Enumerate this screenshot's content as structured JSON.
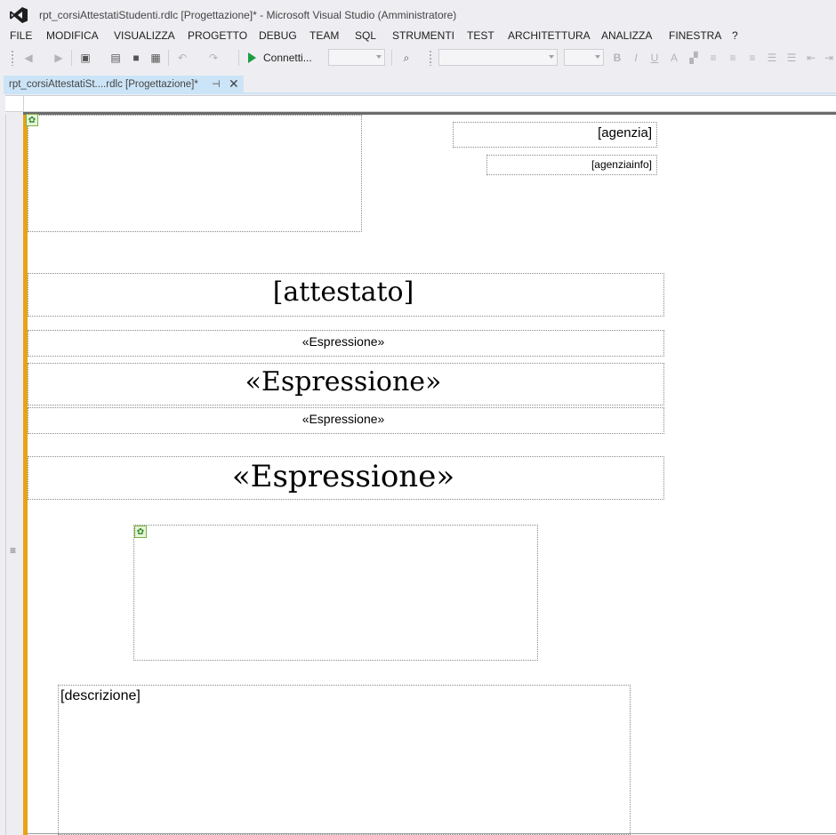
{
  "window": {
    "title": "rpt_corsiAttestatiStudenti.rdlc [Progettazione]* - Microsoft Visual Studio (Amministratore)"
  },
  "menu": [
    "FILE",
    "MODIFICA",
    "VISUALIZZA",
    "PROGETTO",
    "DEBUG",
    "TEAM",
    "SQL",
    "STRUMENTI",
    "TEST",
    "ARCHITETTURA",
    "ANALIZZA",
    "FINESTRA",
    "?"
  ],
  "toolbar": {
    "start_label": "Connetti...",
    "bold_label": "B",
    "italic_label": "I",
    "underline_label": "U"
  },
  "tab": {
    "label": "rpt_corsiAttestatiSt....rdlc [Progettazione]*",
    "pin_glyph": "⊣",
    "close_glyph": "✕"
  },
  "report": {
    "agenzia": "[agenzia]",
    "agenziainfo": "[agenziainfo]",
    "attestato": "[attestato]",
    "expr_small_1": "«Espressione»",
    "expr_large_1": "«Espressione»",
    "expr_small_2": "«Espressione»",
    "expr_large_2": "«Espressione»",
    "descrizione": "[descrizione]"
  },
  "colors": {
    "selection_bar": "#e8a317",
    "tab_active": "#cce4f7",
    "chrome_bg": "#eeeef2"
  },
  "icons": [
    "vs-logo-icon",
    "back-icon",
    "forward-icon",
    "new-project-icon",
    "open-file-icon",
    "save-icon",
    "save-all-icon",
    "undo-icon",
    "redo-icon",
    "start-icon",
    "find-icon",
    "font-color-icon",
    "align-left-icon",
    "align-center-icon",
    "align-right-icon",
    "numbered-list-icon",
    "bullet-list-icon",
    "indent-decrease-icon",
    "indent-increase-icon",
    "image-placeholder-icon"
  ]
}
